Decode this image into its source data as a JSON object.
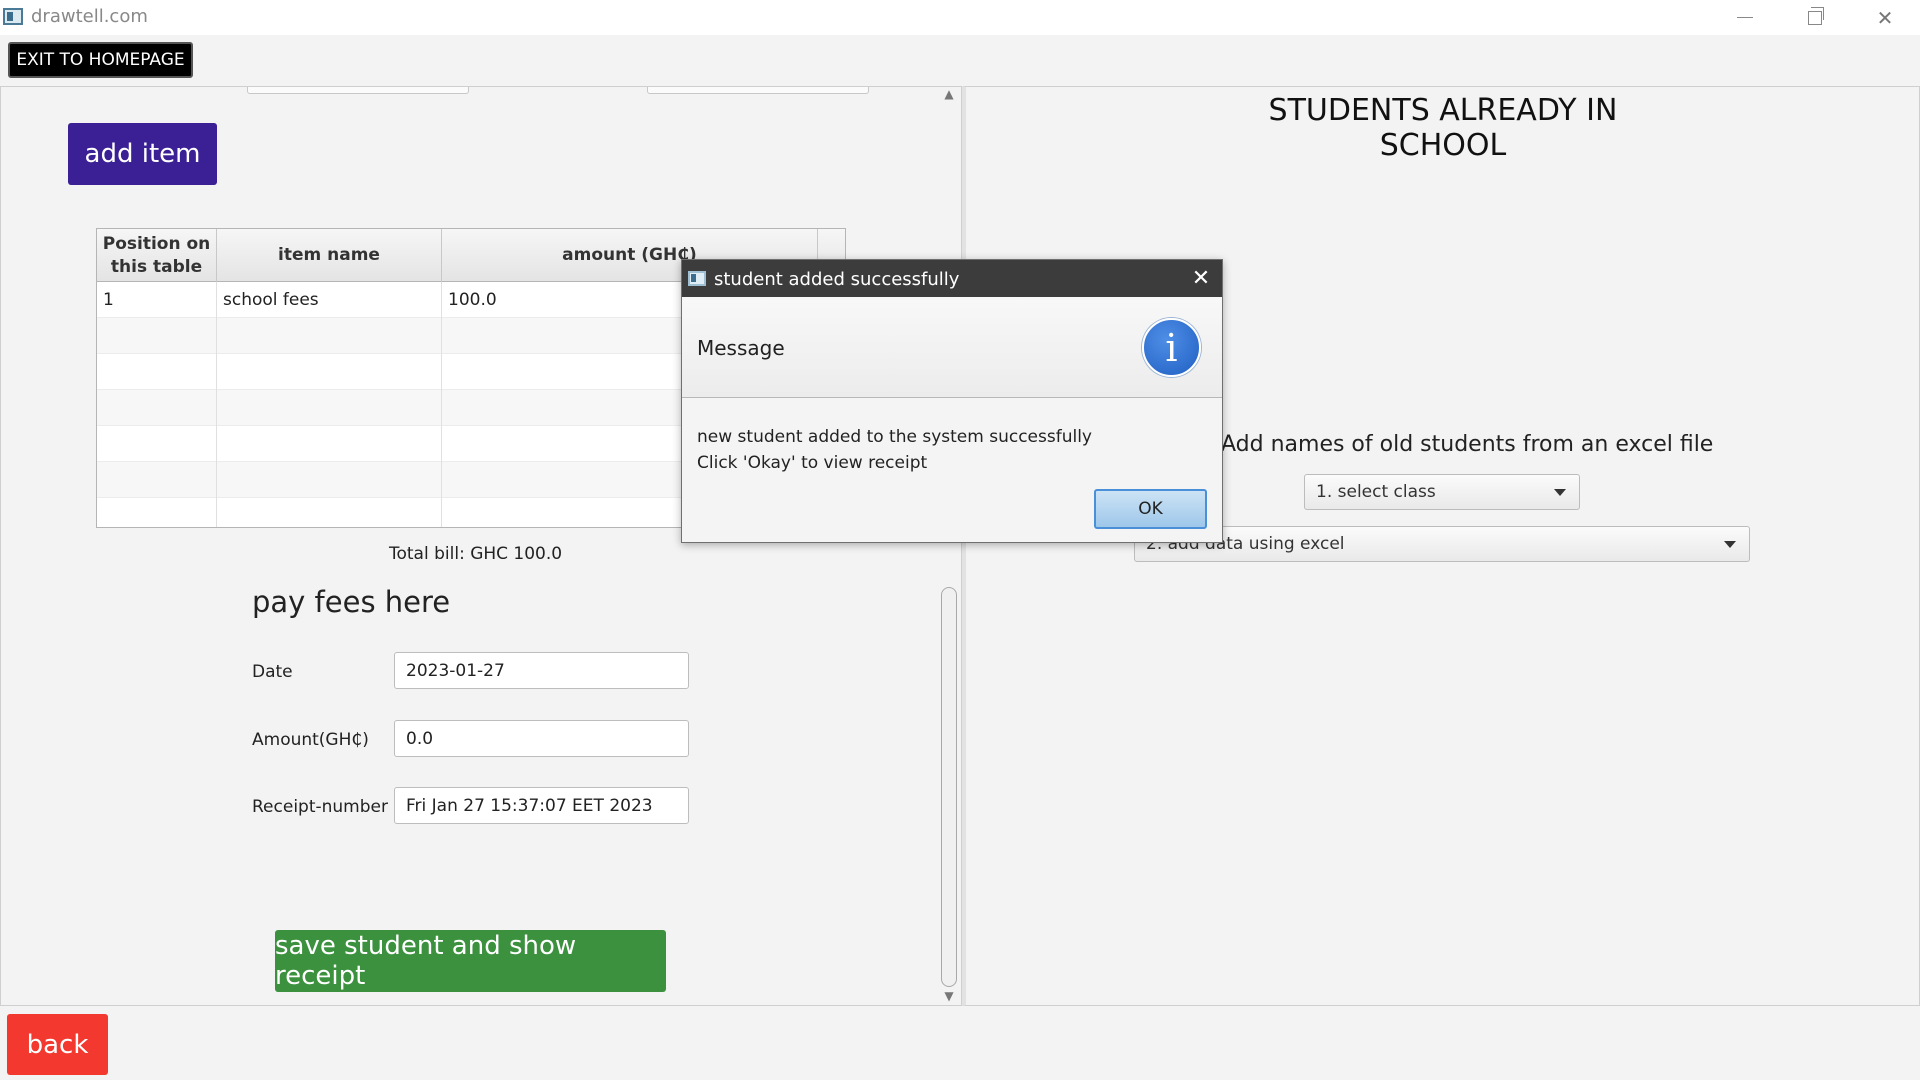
{
  "window": {
    "title": "drawtell.com"
  },
  "topbar": {
    "exit_label": "EXIT TO HOMEPAGE"
  },
  "left": {
    "add_item_label": "add item",
    "table": {
      "headers": [
        "Position on this table",
        "item name",
        "amount (GH₵)"
      ],
      "rows": [
        [
          "1",
          "school fees",
          "100.0"
        ]
      ]
    },
    "total_bill": "Total bill: GHC 100.0",
    "pay_title": "pay fees here",
    "form": {
      "date_label": "Date",
      "date_value": "2023-01-27",
      "amount_label": "Amount(GH₵)",
      "amount_value": "0.0",
      "receipt_label": "Receipt-number",
      "receipt_value": "Fri Jan 27 15:37:07 EET 2023"
    },
    "save_label": "save student and show receipt"
  },
  "right": {
    "title": "STUDENTS ALREADY IN SCHOOL",
    "excel_label": "Add names of old students from an excel file",
    "select_class": "1. select class",
    "select_excel": "2. add data using excel"
  },
  "bottom": {
    "back_label": "back"
  },
  "dialog": {
    "title": "student added successfully",
    "header": "Message",
    "message_line1": "new student added to the system successfully",
    "message_line2": "Click 'Okay' to view receipt",
    "ok_label": "OK"
  },
  "colors": {
    "add_item": "#3b2095",
    "save": "#3b913e",
    "back": "#f3392f",
    "exit": "#000000",
    "dialog_title": "#3c3c3c",
    "info_icon": "#2f6fd1"
  },
  "icons": [
    "app-icon",
    "minimize-icon",
    "maximize-icon",
    "close-icon",
    "info-icon",
    "chevron-down-icon"
  ]
}
